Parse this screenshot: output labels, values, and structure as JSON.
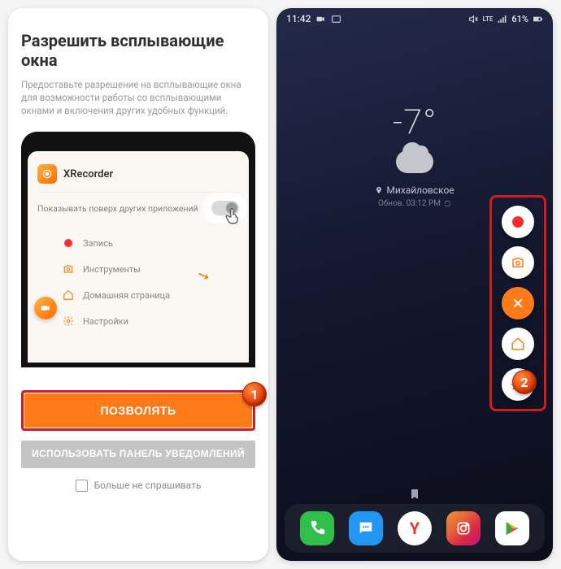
{
  "left": {
    "title": "Разрешить всплывающие окна",
    "description": "Предоставьте разрешение на всплывающие окна для возможности работы со всплывающими окнами и включения других удобных функций.",
    "app_name": "XRecorder",
    "overlay_label": "Показывать поверх других приложений",
    "menu": {
      "record": "Запись",
      "tools": "Инструменты",
      "home": "Домашняя страница",
      "settings": "Настройки"
    },
    "primary_btn": "ПОЗВОЛЯТЬ",
    "secondary_btn": "ИСПОЛЬЗОВАТЬ ПАНЕЛЬ УВЕДОМЛЕНИЙ",
    "dont_ask": "Больше не спрашивать",
    "step": "1"
  },
  "right": {
    "time": "11:42",
    "battery": "61%",
    "net_label": "LTE",
    "temp": "-7°",
    "location": "Михайловское",
    "updated": "Обнов. 03:12 PM",
    "step": "2",
    "dock": {
      "phone": "phone",
      "messages": "messages",
      "yandex": "Y",
      "instagram": "instagram",
      "play": "play-store"
    }
  }
}
